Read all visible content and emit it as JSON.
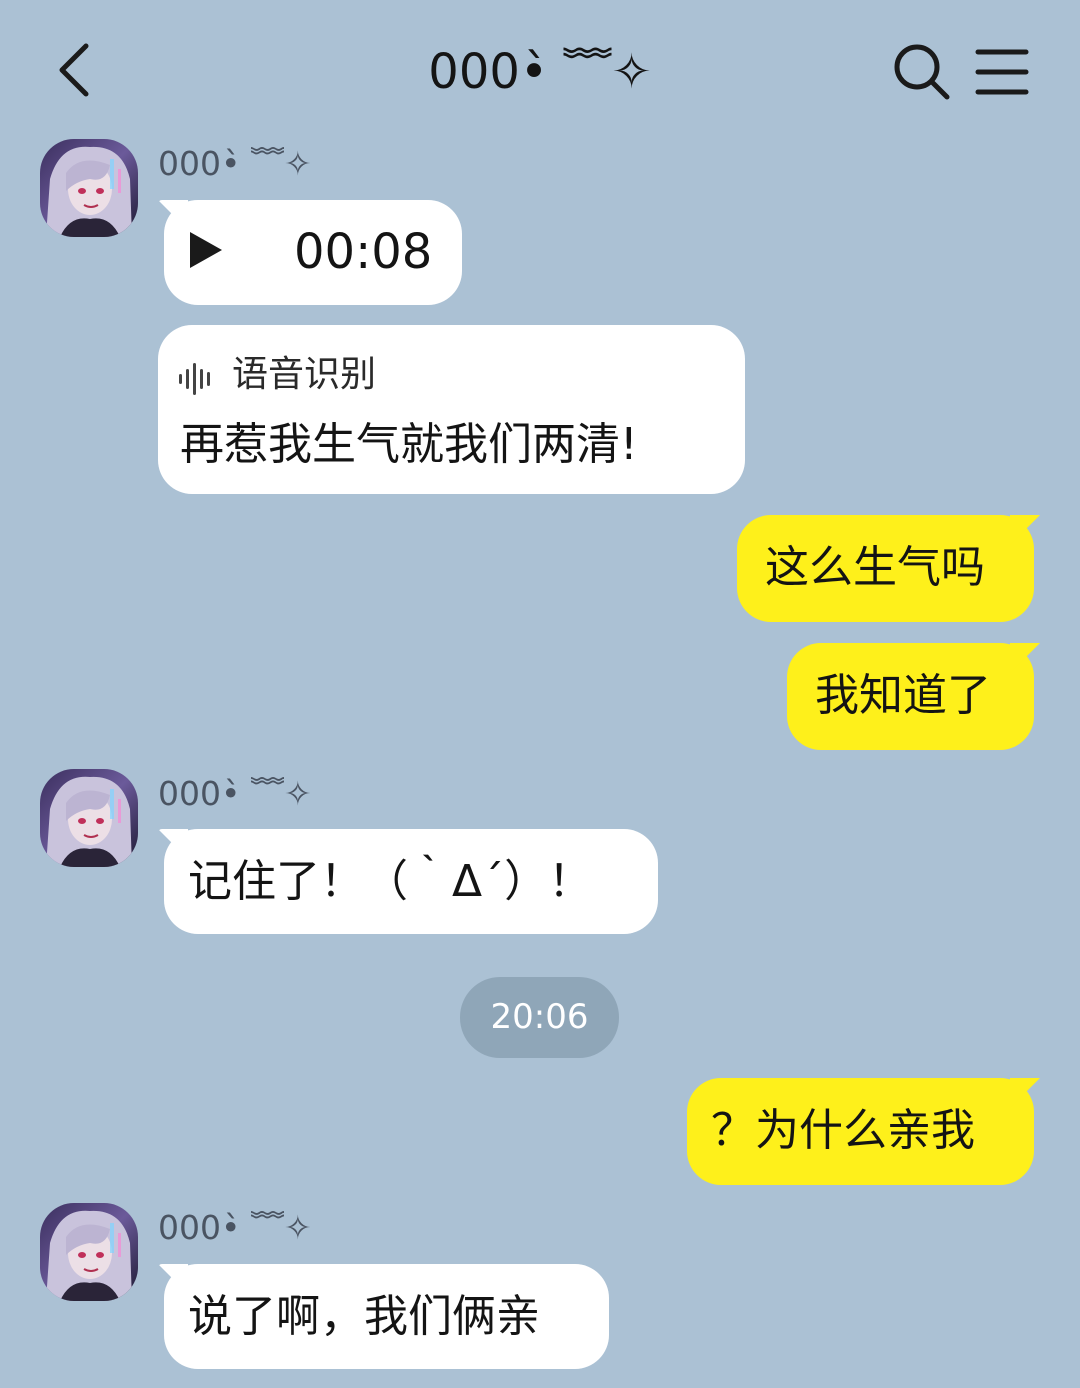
{
  "header": {
    "title": "000•̀ ﹌✧",
    "back_icon": "chevron-left-icon",
    "search_icon": "search-icon",
    "menu_icon": "menu-icon"
  },
  "colors": {
    "background": "#abc1d4",
    "incoming_bubble": "#ffffff",
    "outgoing_bubble": "#fef01b",
    "time_pill": "#8fa6b8"
  },
  "messages": [
    {
      "direction": "incoming",
      "sender": "000•̀ ﹌✧",
      "type": "voice",
      "duration": "00:08",
      "transcript_label": "语音识别",
      "transcript_text": "再惹我生气就我们两清!"
    },
    {
      "direction": "outgoing",
      "text": "这么生气吗"
    },
    {
      "direction": "outgoing",
      "text": "我知道了"
    },
    {
      "direction": "incoming",
      "sender": "000•̀ ﹌✧",
      "text": "记住了！（｀Δ´）！"
    },
    {
      "direction": "outgoing",
      "text": "？为什么亲我"
    },
    {
      "direction": "incoming",
      "sender": "000•̀ ﹌✧",
      "text": "说了啊，我们俩亲"
    }
  ],
  "timestamp": "20:06"
}
